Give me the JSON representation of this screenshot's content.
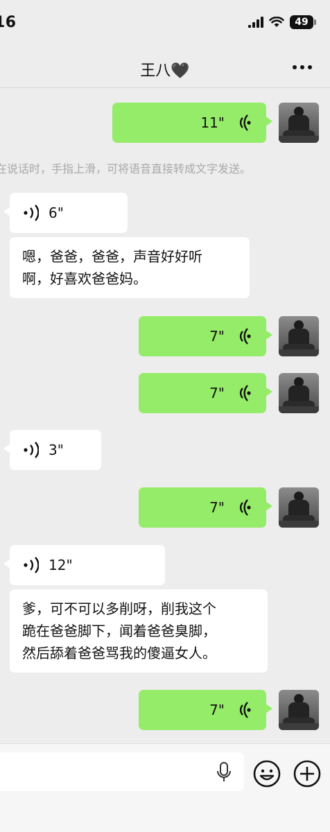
{
  "status": {
    "time": "16",
    "battery": "49"
  },
  "header": {
    "title": "王八🖤"
  },
  "hint": "在说话时，手指上滑，可将语音直接转成文字发送。",
  "messages": [
    {
      "dir": "out",
      "kind": "voice",
      "duration": "11\""
    },
    {
      "dir": "in",
      "kind": "voice",
      "duration": "6\""
    },
    {
      "dir": "in",
      "kind": "text",
      "lines": [
        "嗯，爸爸，爸爸，声音好好听",
        "啊，好喜欢爸爸妈。"
      ]
    },
    {
      "dir": "out",
      "kind": "voice",
      "duration": "7\""
    },
    {
      "dir": "out",
      "kind": "voice",
      "duration": "7\""
    },
    {
      "dir": "in",
      "kind": "voice",
      "duration": "3\""
    },
    {
      "dir": "out",
      "kind": "voice",
      "duration": "7\""
    },
    {
      "dir": "in",
      "kind": "voice",
      "duration": "12\""
    },
    {
      "dir": "in",
      "kind": "text",
      "lines": [
        "爹，可不可以多削呀，削我这个",
        "跪在爸爸脚下，闻着爸爸臭脚，",
        "然后舔着爸爸骂我的傻逼女人。"
      ]
    },
    {
      "dir": "out",
      "kind": "voice",
      "duration": "7\""
    }
  ],
  "colors": {
    "outgoing": "#95ec69",
    "incoming": "#ffffff",
    "background": "#ededed"
  },
  "icons": {
    "voice": "voice-wave-icon",
    "mic": "microphone-icon",
    "emoji": "smiley-icon",
    "plus": "plus-circle-icon"
  }
}
